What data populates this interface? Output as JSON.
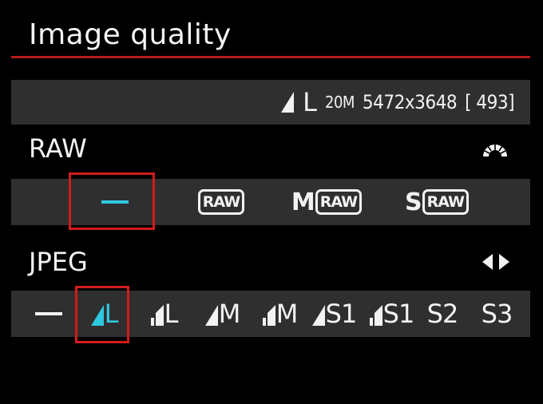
{
  "header": {
    "title": "Image quality"
  },
  "info_bar": {
    "size_letter": "L",
    "megapixels": "20M",
    "resolution": "5472x3648",
    "shots_remaining": "[ 493]"
  },
  "raw": {
    "label": "RAW",
    "dial_icon": "main-dial-icon",
    "options": [
      {
        "prefix": "",
        "badge": "",
        "label": "—",
        "selected": true
      },
      {
        "prefix": "",
        "badge": "RAW",
        "label": "",
        "selected": false
      },
      {
        "prefix": "M",
        "badge": "RAW",
        "label": "",
        "selected": false
      },
      {
        "prefix": "S",
        "badge": "RAW",
        "label": "",
        "selected": false
      }
    ]
  },
  "jpeg": {
    "label": "JPEG",
    "arrows_icon": "left-right-arrows-icon",
    "options": [
      {
        "glyph": "none",
        "label": "—",
        "selected": false
      },
      {
        "glyph": "fine",
        "label": "L",
        "selected": true
      },
      {
        "glyph": "normal",
        "label": "L",
        "selected": false
      },
      {
        "glyph": "fine",
        "label": "M",
        "selected": false
      },
      {
        "glyph": "normal",
        "label": "M",
        "selected": false
      },
      {
        "glyph": "fine",
        "label": "S1",
        "selected": false
      },
      {
        "glyph": "normal",
        "label": "S1",
        "selected": false
      },
      {
        "glyph": "none",
        "label": "S2",
        "selected": false
      },
      {
        "glyph": "none",
        "label": "S3",
        "selected": false
      }
    ]
  },
  "colors": {
    "background": "#000000",
    "bar": "#2f2f2f",
    "accent_rule": "#b41b1b",
    "selection_frame": "#d01c1c",
    "selected_text": "#2ec8e0",
    "text": "#f2f2f2"
  }
}
